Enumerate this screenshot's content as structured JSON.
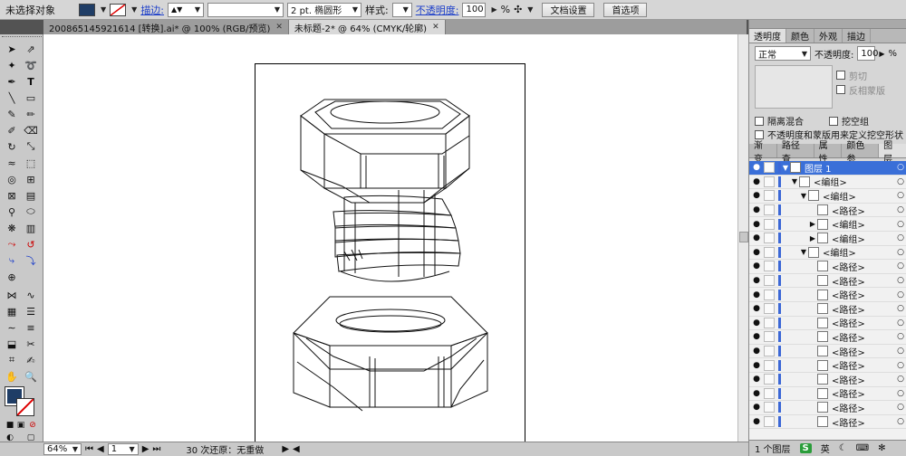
{
  "control_bar": {
    "selection_status": "未选择对象",
    "stroke_label": "描边:",
    "stroke_weight": "2 pt. 椭圆形",
    "style_label": "样式:",
    "opacity_label": "不透明度:",
    "opacity_value": "100",
    "opacity_unit": "%",
    "doc_setup_button": "文档设置",
    "preferences_button": "首选项"
  },
  "document_tabs": [
    {
      "label": "200865145921614  [转换].ai* @ 100% (RGB/预览)"
    },
    {
      "label": "未标题-2* @ 64% (CMYK/轮廓)"
    }
  ],
  "status_bar": {
    "zoom": "64%",
    "page": "1",
    "undo_text": "30 次还原：无重做"
  },
  "transparency_panel": {
    "tabs": [
      "透明度",
      "颜色",
      "外观",
      "描边"
    ],
    "blend_mode": "正常",
    "opacity_label": "不透明度:",
    "opacity_value": "100",
    "opacity_unit": "%",
    "clip_label": "剪切",
    "invert_mask_label": "反相蒙版",
    "isolate_blending_label": "隔离混合",
    "knockout_group_label": "挖空组",
    "opacity_mask_label": "不透明度和蒙版用来定义挖空形状"
  },
  "layers_panel": {
    "tabs": [
      "渐变",
      "路径查",
      "属性",
      "颜色参",
      "图层"
    ],
    "rows": [
      {
        "name": "图层 1",
        "indent": 0,
        "expand": "down",
        "selected": true
      },
      {
        "name": "<编组>",
        "indent": 1,
        "expand": "down"
      },
      {
        "name": "<编组>",
        "indent": 2,
        "expand": "down"
      },
      {
        "name": "<路径>",
        "indent": 3,
        "expand": ""
      },
      {
        "name": "<编组>",
        "indent": 3,
        "expand": "right"
      },
      {
        "name": "<编组>",
        "indent": 3,
        "expand": "right"
      },
      {
        "name": "<编组>",
        "indent": 2,
        "expand": "down"
      },
      {
        "name": "<路径>",
        "indent": 3,
        "expand": ""
      },
      {
        "name": "<路径>",
        "indent": 3,
        "expand": ""
      },
      {
        "name": "<路径>",
        "indent": 3,
        "expand": ""
      },
      {
        "name": "<路径>",
        "indent": 3,
        "expand": ""
      },
      {
        "name": "<路径>",
        "indent": 3,
        "expand": ""
      },
      {
        "name": "<路径>",
        "indent": 3,
        "expand": ""
      },
      {
        "name": "<路径>",
        "indent": 3,
        "expand": ""
      },
      {
        "name": "<路径>",
        "indent": 3,
        "expand": ""
      },
      {
        "name": "<路径>",
        "indent": 3,
        "expand": ""
      },
      {
        "name": "<路径>",
        "indent": 3,
        "expand": ""
      },
      {
        "name": "<路径>",
        "indent": 3,
        "expand": ""
      },
      {
        "name": "<路径>",
        "indent": 3,
        "expand": ""
      }
    ],
    "footer": "1 个图层",
    "ime_label": "英"
  },
  "colors": {
    "fill": "#1f3d66",
    "stroke_none": "#ffffff",
    "selection": "#3a6fd8"
  }
}
